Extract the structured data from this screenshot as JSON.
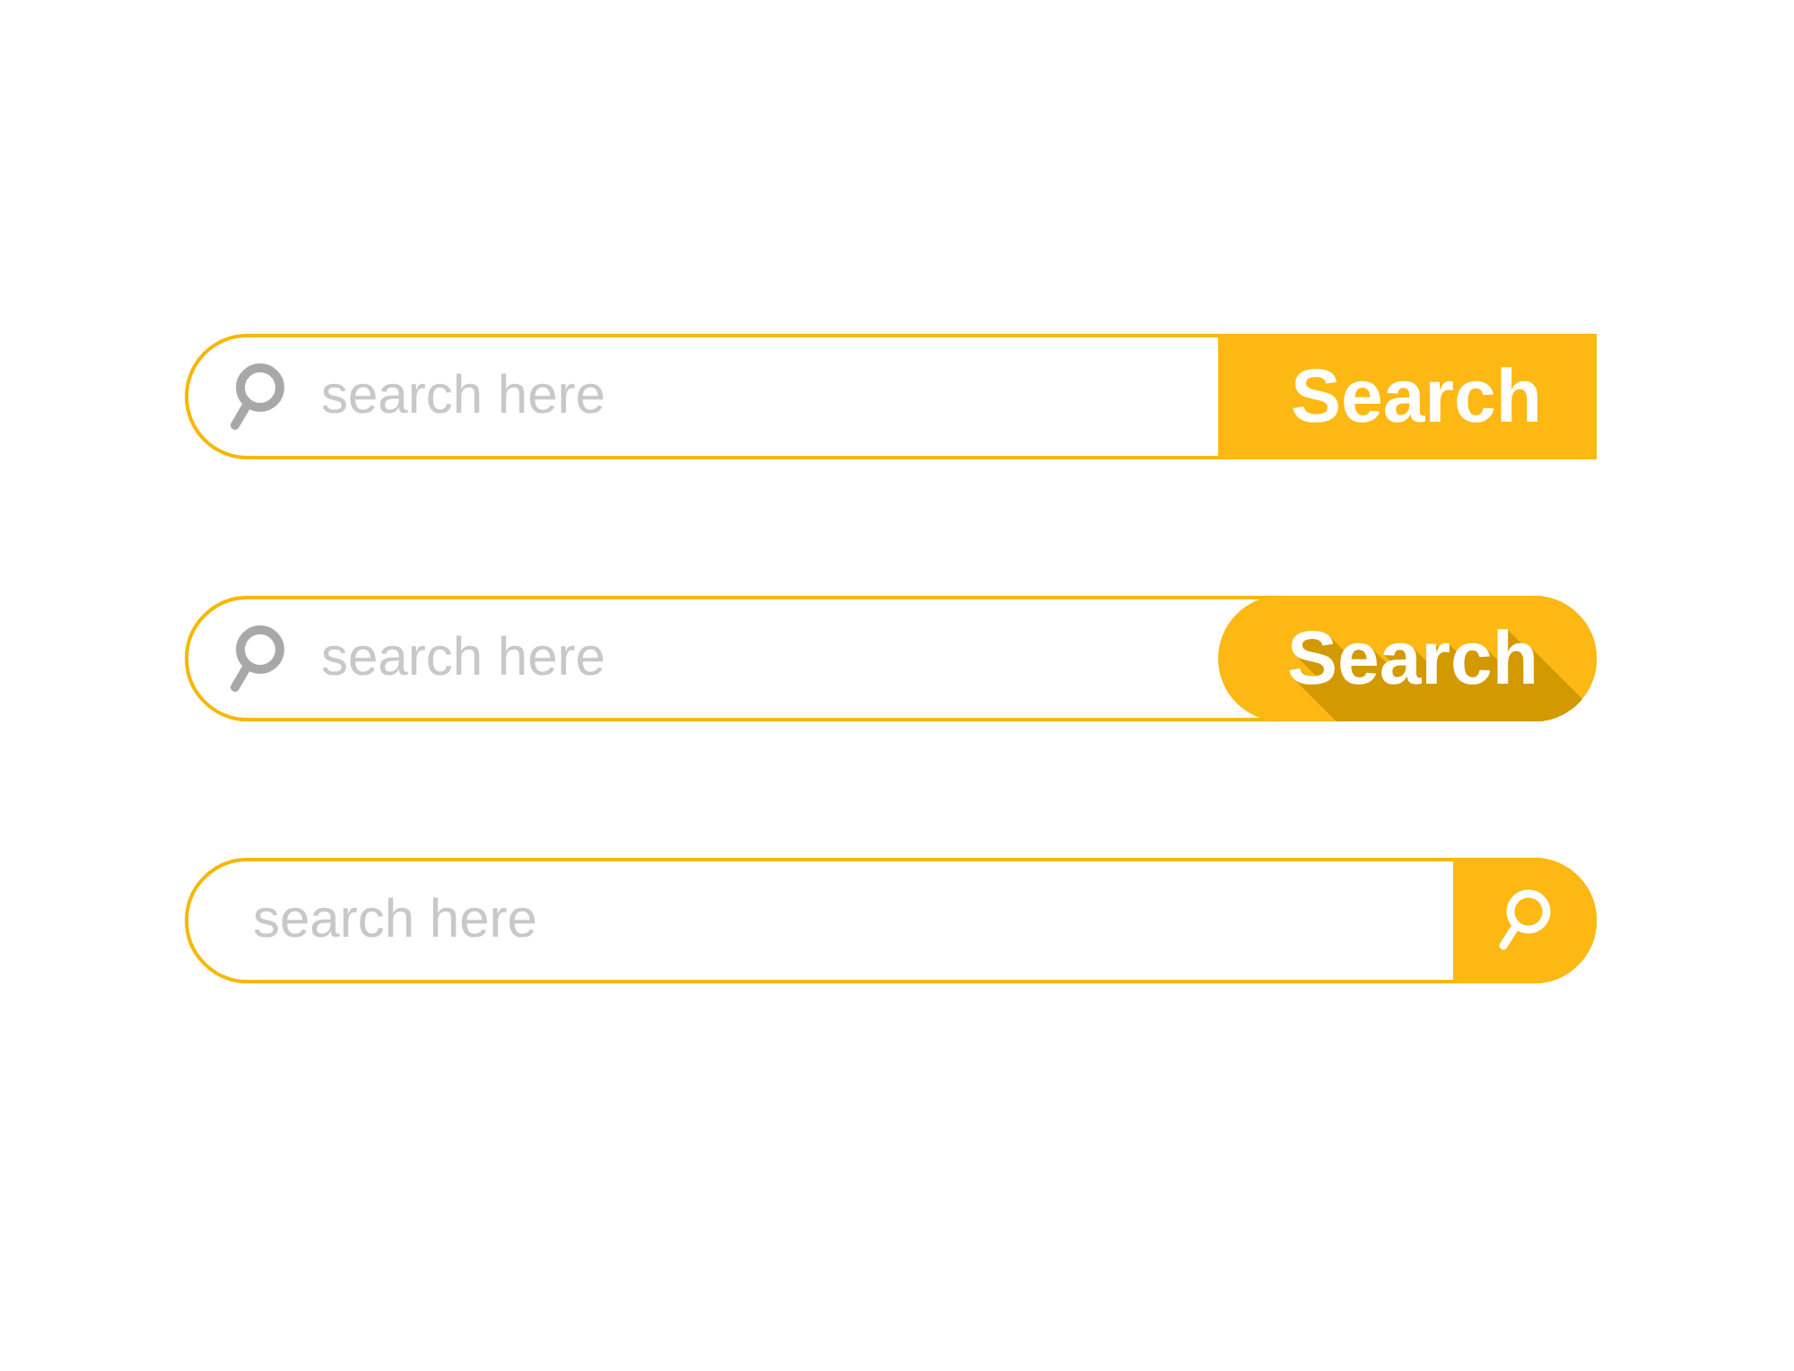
{
  "search_bars": [
    {
      "kind": "square-button",
      "placeholder": "search here",
      "button": "Search"
    },
    {
      "kind": "pill-button",
      "placeholder": "search here",
      "button": "Search"
    },
    {
      "kind": "icon-button",
      "placeholder": "search here"
    }
  ]
}
